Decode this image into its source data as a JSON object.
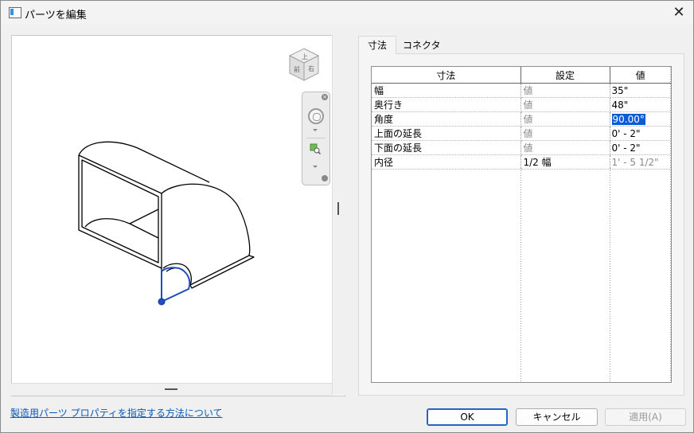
{
  "window": {
    "title": "パーツを編集",
    "close_symbol": "✕"
  },
  "viewcube": {
    "top_face": "上",
    "front_face": "前",
    "right_face": "右"
  },
  "tabs": [
    {
      "label": "寸法",
      "active": true
    },
    {
      "label": "コネクタ",
      "active": false
    }
  ],
  "grid": {
    "headers": [
      "寸法",
      "設定",
      "値"
    ],
    "rows": [
      {
        "name": "幅",
        "setting": "値",
        "value": "35\"",
        "setting_gray": true,
        "value_gray": false
      },
      {
        "name": "奥行き",
        "setting": "値",
        "value": "48\"",
        "setting_gray": true,
        "value_gray": false
      },
      {
        "name": "角度",
        "setting": "値",
        "value": "90.00°",
        "setting_gray": true,
        "value_gray": false,
        "selected": true
      },
      {
        "name": "上面の延長",
        "setting": "値",
        "value": "0' - 2\"",
        "setting_gray": true,
        "value_gray": false
      },
      {
        "name": "下面の延長",
        "setting": "値",
        "value": "0' - 2\"",
        "setting_gray": true,
        "value_gray": false
      },
      {
        "name": "内径",
        "setting": "1/2 幅",
        "value": "1' - 5 1/2\"",
        "setting_gray": false,
        "value_gray": true
      }
    ]
  },
  "footer": {
    "help_link": "製造用パーツ プロパティを指定する方法について",
    "ok_label": "OK",
    "cancel_label": "キャンセル",
    "apply_label": "適用(A)"
  },
  "colors": {
    "accent": "#0a5cd6",
    "link": "#0a5ab5",
    "connector": "#1f4fbf"
  }
}
